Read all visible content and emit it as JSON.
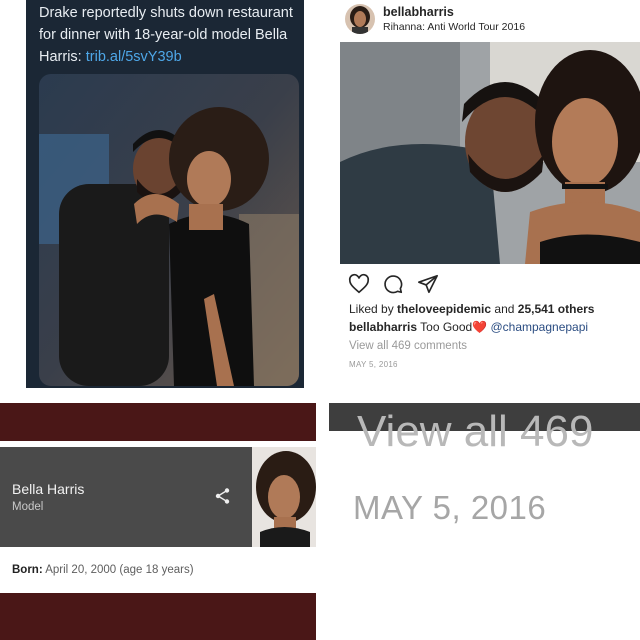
{
  "tweet": {
    "text": "Drake reportedly shuts down restaurant for dinner with 18-year-old model Bella Harris: ",
    "link": "trib.al/5svY39b"
  },
  "instagram": {
    "username": "bellabharris",
    "location": "Rihanna: Anti World Tour 2016",
    "icons": [
      "heart-icon",
      "comment-icon",
      "share-icon"
    ],
    "likes_prefix": "Liked by ",
    "likes_user": "theloveepidemic",
    "likes_middle": " and ",
    "likes_count": "25,541 others",
    "caption_user": "bellabharris",
    "caption_text": " Too Good",
    "caption_emoji": "❤️",
    "caption_mention": " @champagnepapi",
    "comments_link": "View all 469 comments",
    "date": "MAY 5, 2016"
  },
  "knowledge_card": {
    "name": "Bella Harris",
    "role": "Model",
    "born_label": "Born:",
    "born_value": " April 20, 2000 (age 18 years)",
    "share_icon": "share-icon"
  },
  "zoom": {
    "comments_fragment": "View all 469",
    "date": "MAY 5, 2016"
  },
  "colors": {
    "tweet_bg": "#1b2735",
    "link_blue": "#4ea7e8",
    "card_dark": "#4a4a4a",
    "maroon_bar": "#4a1717",
    "ig_mention": "#2b4d82"
  }
}
